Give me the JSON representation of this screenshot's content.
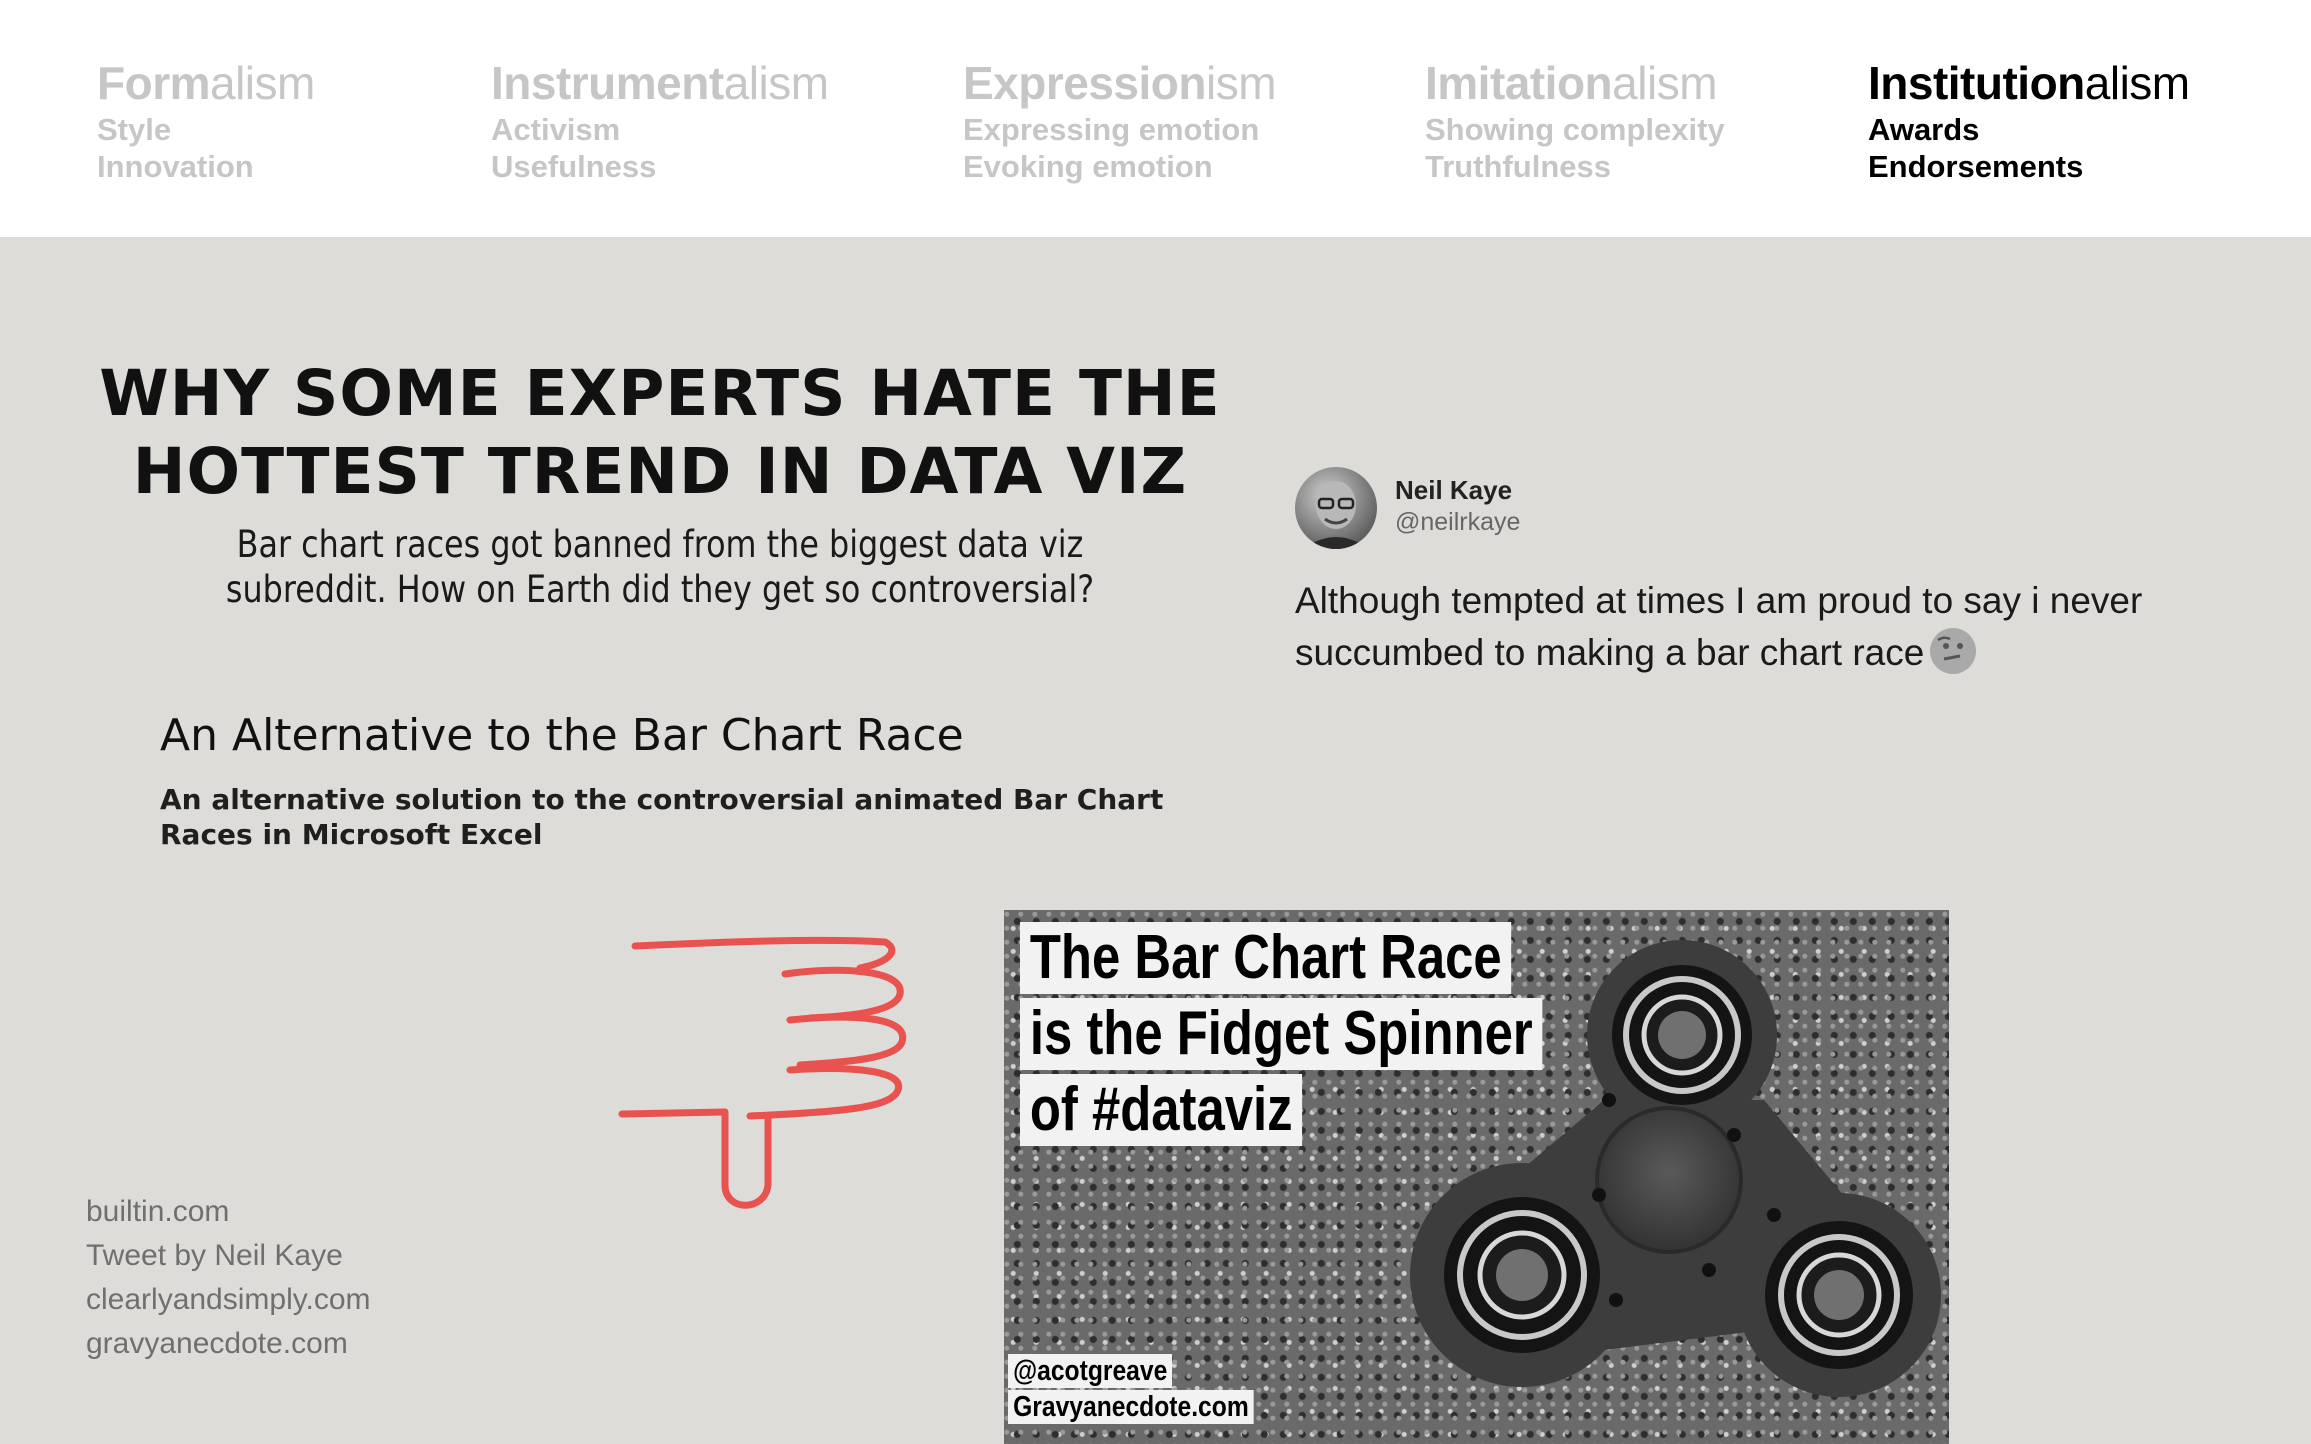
{
  "header": {
    "columns": [
      {
        "bold": "Form",
        "light": "alism",
        "sub1": "Style",
        "sub2": "Innovation",
        "active": false
      },
      {
        "bold": "Instrument",
        "light": "alism",
        "sub1": "Activism",
        "sub2": "Usefulness",
        "active": false
      },
      {
        "bold": "Expression",
        "light": "ism",
        "sub1": "Expressing emotion",
        "sub2": "Evoking emotion",
        "active": false
      },
      {
        "bold": "Imitation",
        "light": "alism",
        "sub1": "Showing complexity",
        "sub2": "Truthfulness",
        "active": false
      },
      {
        "bold": "Institution",
        "light": "alism",
        "sub1": "Awards",
        "sub2": "Endorsements",
        "active": true
      }
    ]
  },
  "article": {
    "headline_line1": "WHY SOME EXPERTS HATE THE",
    "headline_line2": "HOTTEST TREND IN DATA VIZ",
    "subhead_line1": "Bar chart races got banned from the biggest data viz",
    "subhead_line2": "subreddit. How on Earth did they get so controversial?"
  },
  "alternative": {
    "title": "An Alternative to the Bar Chart Race",
    "description": "An alternative solution to the controversial animated Bar Chart Races in Microsoft Excel"
  },
  "tweet": {
    "name": "Neil Kaye",
    "handle": "@neilrkaye",
    "text": "Although tempted at times I am proud to say i never succumbed to making a bar chart race",
    "emoji_icon": "thinking-face-icon"
  },
  "sketch": {
    "icon": "thumbs-down-sketch-icon",
    "color": "#e8524f"
  },
  "image_caption": {
    "line1": "The Bar Chart Race",
    "line2": "is the Fidget Spinner",
    "line3": "of #dataviz",
    "credit1": "@acotgreave",
    "credit2": "Gravyanecdote.com"
  },
  "sources": [
    "builtin.com",
    "Tweet by Neil Kaye",
    "clearlyandsimply.com",
    "gravyanecdote.com"
  ]
}
